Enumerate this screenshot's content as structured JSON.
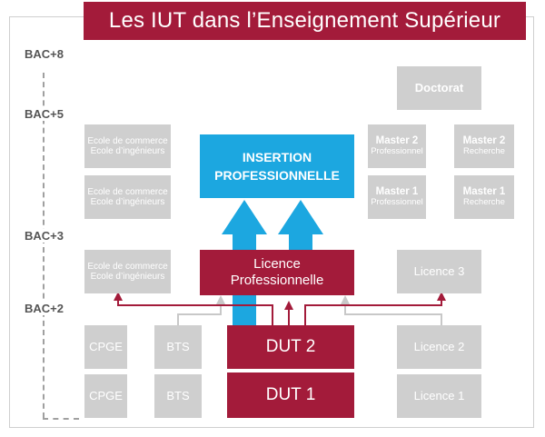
{
  "title": "Les IUT dans l’Enseignement Supérieur",
  "levels": [
    "BAC+8",
    "BAC+5",
    "BAC+3",
    "BAC+2"
  ],
  "doctorat": "Doctorat",
  "insertion": {
    "line1": "INSERTION",
    "line2": "PROFESSIONNELLE"
  },
  "licence_pro": {
    "line1": "Licence",
    "line2": "Professionnelle"
  },
  "dut2": "DUT 2",
  "dut1": "DUT 1",
  "ecoles": {
    "line1": "Ecole de commerce",
    "line2": "Ecole d’ingénieurs"
  },
  "master2_pro": {
    "title": "Master 2",
    "sub": "Professionnel"
  },
  "master2_rech": {
    "title": "Master 2",
    "sub": "Recherche"
  },
  "master1_pro": {
    "title": "Master 1",
    "sub": "Professionnel"
  },
  "master1_rech": {
    "title": "Master 1",
    "sub": "Recherche"
  },
  "licence3": "Licence 3",
  "licence2": "Licence 2",
  "licence1": "Licence 1",
  "cpge": "CPGE",
  "bts": "BTS",
  "colors": {
    "crimson": "#a31b3a",
    "blue": "#1ca7e0",
    "grey": "#cfcfcf"
  }
}
